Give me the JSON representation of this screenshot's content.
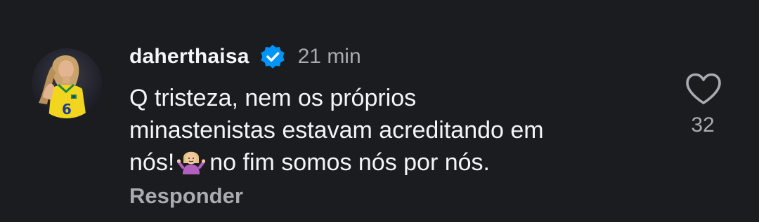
{
  "comment": {
    "username": "daherthaisa",
    "verified_icon": "verified-badge-icon",
    "time": "21 min",
    "text_lines": [
      "Q tristeza, nem os próprios",
      "minastenistas estavam acreditando em",
      "nós!",
      "no fim somos nós por nós."
    ],
    "emoji_icon": "person-shrugging-emoji",
    "reply_label": "Responder",
    "like_icon": "heart-icon",
    "like_count": "32",
    "colors": {
      "background": "#1b1c20",
      "primary_text": "#f3f5f7",
      "secondary_text": "#a8abb2",
      "verified_blue": "#0095f6"
    }
  }
}
